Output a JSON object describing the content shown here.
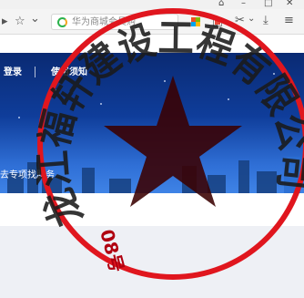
{
  "window": {
    "controls": {
      "pin": "⌂",
      "minimize": "–",
      "maximize": "□",
      "close": "✕"
    }
  },
  "toolbar": {
    "page_action": "▸",
    "favorite": "☆",
    "favorite_menu": "⌄",
    "address_text": "华为商城会员购",
    "cut_label": "✂",
    "cut_menu": "⌄",
    "download_label": "⤓",
    "menu_label": "≡"
  },
  "site": {
    "nav": {
      "login": "登录",
      "guide": "使用须知"
    },
    "banner_text": "去专项找服务"
  },
  "seal": {
    "text": "龙江福轩建设工程有限公司",
    "code": "08号",
    "color": "#e0161e"
  },
  "colors": {
    "banner_top": "#0a2a73",
    "banner_bottom": "#3f83e6",
    "seal_red": "#e0161e"
  }
}
